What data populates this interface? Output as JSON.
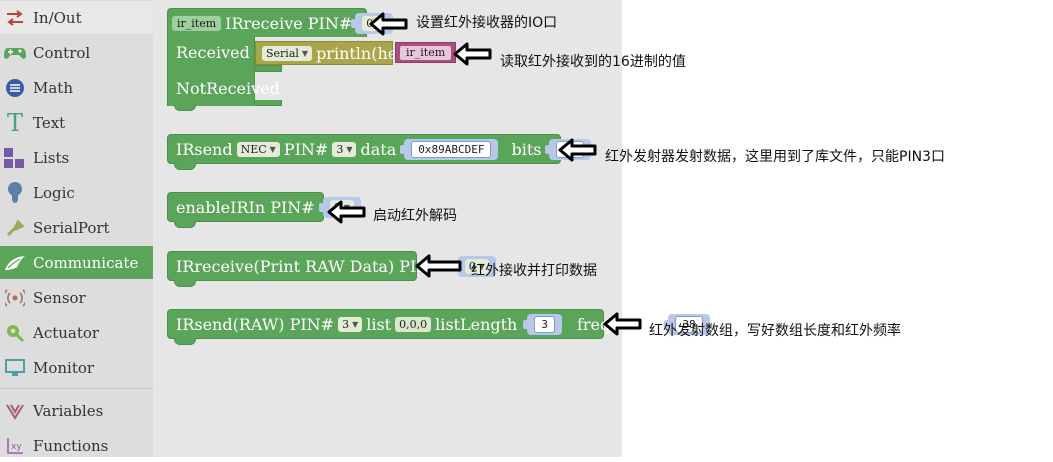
{
  "sidebar": {
    "items": [
      {
        "label": "In/Out",
        "icon": "swap-arrows-icon",
        "color": "#c0392b"
      },
      {
        "label": "Control",
        "icon": "gamepad-icon",
        "color": "#5ba55b"
      },
      {
        "label": "Math",
        "icon": "math-circle-icon",
        "color": "#3b5ba5"
      },
      {
        "label": "Text",
        "icon": "text-t-icon",
        "color": "#5ba58c"
      },
      {
        "label": "Lists",
        "icon": "lists-blocks-icon",
        "color": "#745ba5"
      },
      {
        "label": "Logic",
        "icon": "lightbulb-icon",
        "color": "#5b80a5"
      },
      {
        "label": "SerialPort",
        "icon": "usb-plug-icon",
        "color": "#a5a55b"
      },
      {
        "label": "Communicate",
        "icon": "bird-icon",
        "color": "#5ba55b"
      },
      {
        "label": "Sensor",
        "icon": "radar-icon",
        "color": "#a5745b"
      },
      {
        "label": "Actuator",
        "icon": "gear-bulb-icon",
        "color": "#5ba55b"
      },
      {
        "label": "Monitor",
        "icon": "monitor-icon",
        "color": "#5ba5a5"
      },
      {
        "label": "Variables",
        "icon": "variables-icon",
        "color": "#a55b80"
      },
      {
        "label": "Functions",
        "icon": "function-xy-icon",
        "color": "#995ba5"
      }
    ],
    "selected": "Communicate"
  },
  "blocks": {
    "ir_receive": {
      "var": "ir_item",
      "label": "IRreceive PIN#",
      "pin": "0",
      "received": "Received",
      "serial": "Serial",
      "println": "println(hex)",
      "var_ref": "ir_item",
      "not_received": "NotReceived"
    },
    "ir_send": {
      "label": "IRsend",
      "protocol": "NEC",
      "pin_label": "PIN#",
      "pin": "3",
      "data_label": "data",
      "data": "0x89ABCDEF",
      "bits_label": "bits",
      "bits": "32"
    },
    "enable_irin": {
      "label": "enableIRIn PIN#",
      "pin": "0"
    },
    "ir_receive_raw": {
      "label": "IRreceive(Print RAW Data) PIN#",
      "pin": "0"
    },
    "ir_send_raw": {
      "label": "IRsend(RAW) PIN#",
      "pin": "3",
      "list_label": "list",
      "list": "0,0,0",
      "length_label": "listLength",
      "length": "3",
      "freq_label": "frequency",
      "freq": "38"
    }
  },
  "annotations": {
    "a1": "设置红外接收器的IO口",
    "a2": "读取红外接收到的16进制的值",
    "a3": "红外发射器发射数据，这里用到了库文件，只能PIN3口",
    "a4": "启动红外解码",
    "a5": "红外接收并打印数据",
    "a6": "红外发射数组，写好数组长度和红外频率"
  }
}
